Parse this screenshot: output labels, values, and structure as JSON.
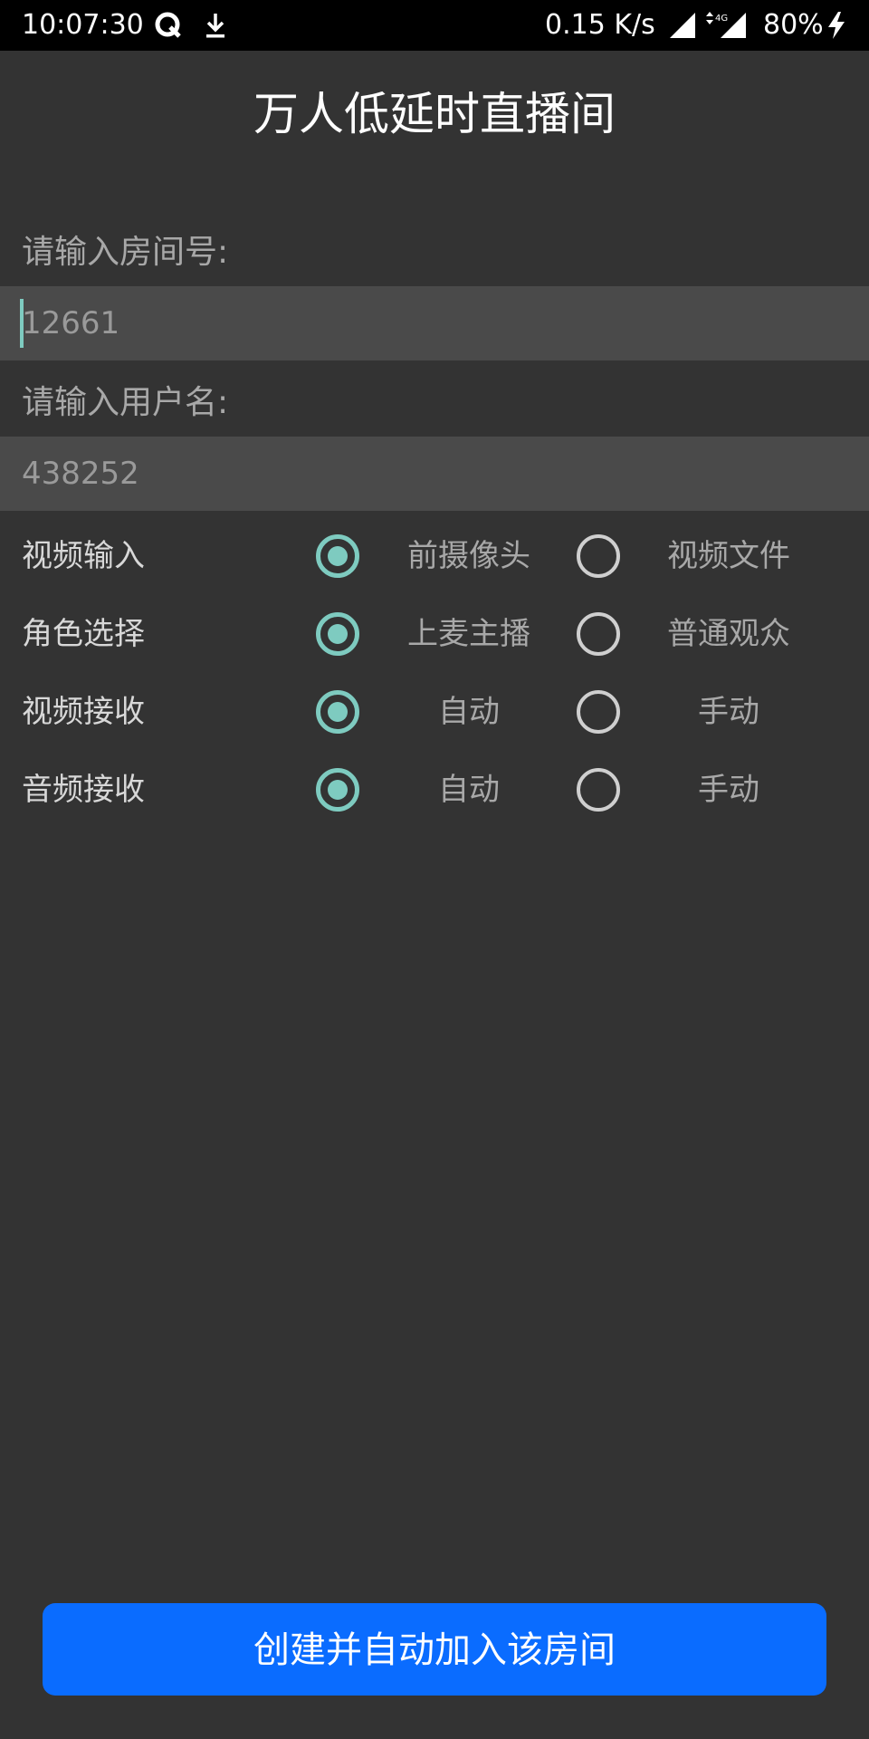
{
  "status_bar": {
    "time": "10:07:30",
    "net_speed": "0.15 K/s",
    "network_type": "4G",
    "battery": "80%",
    "icons": [
      "q-app-icon",
      "download-icon",
      "signal-icon",
      "mobile-data-signal-icon",
      "charging-icon"
    ]
  },
  "title": "万人低延时直播间",
  "room": {
    "label": "请输入房间号:",
    "placeholder": "12661"
  },
  "user": {
    "label": "请输入用户名:",
    "placeholder": "438252"
  },
  "options": [
    {
      "label": "视频输入",
      "choice1": "前摄像头",
      "choice2": "视频文件",
      "selected": 1
    },
    {
      "label": "角色选择",
      "choice1": "上麦主播",
      "choice2": "普通观众",
      "selected": 1
    },
    {
      "label": "视频接收",
      "choice1": "自动",
      "choice2": "手动",
      "selected": 1
    },
    {
      "label": "音频接收",
      "choice1": "自动",
      "choice2": "手动",
      "selected": 1
    }
  ],
  "create_button_label": "创建并自动加入该房间",
  "colors": {
    "background": "#333333",
    "input_background": "#4a4a4a",
    "accent": "#7ecbc0",
    "button": "#0a6cff"
  }
}
